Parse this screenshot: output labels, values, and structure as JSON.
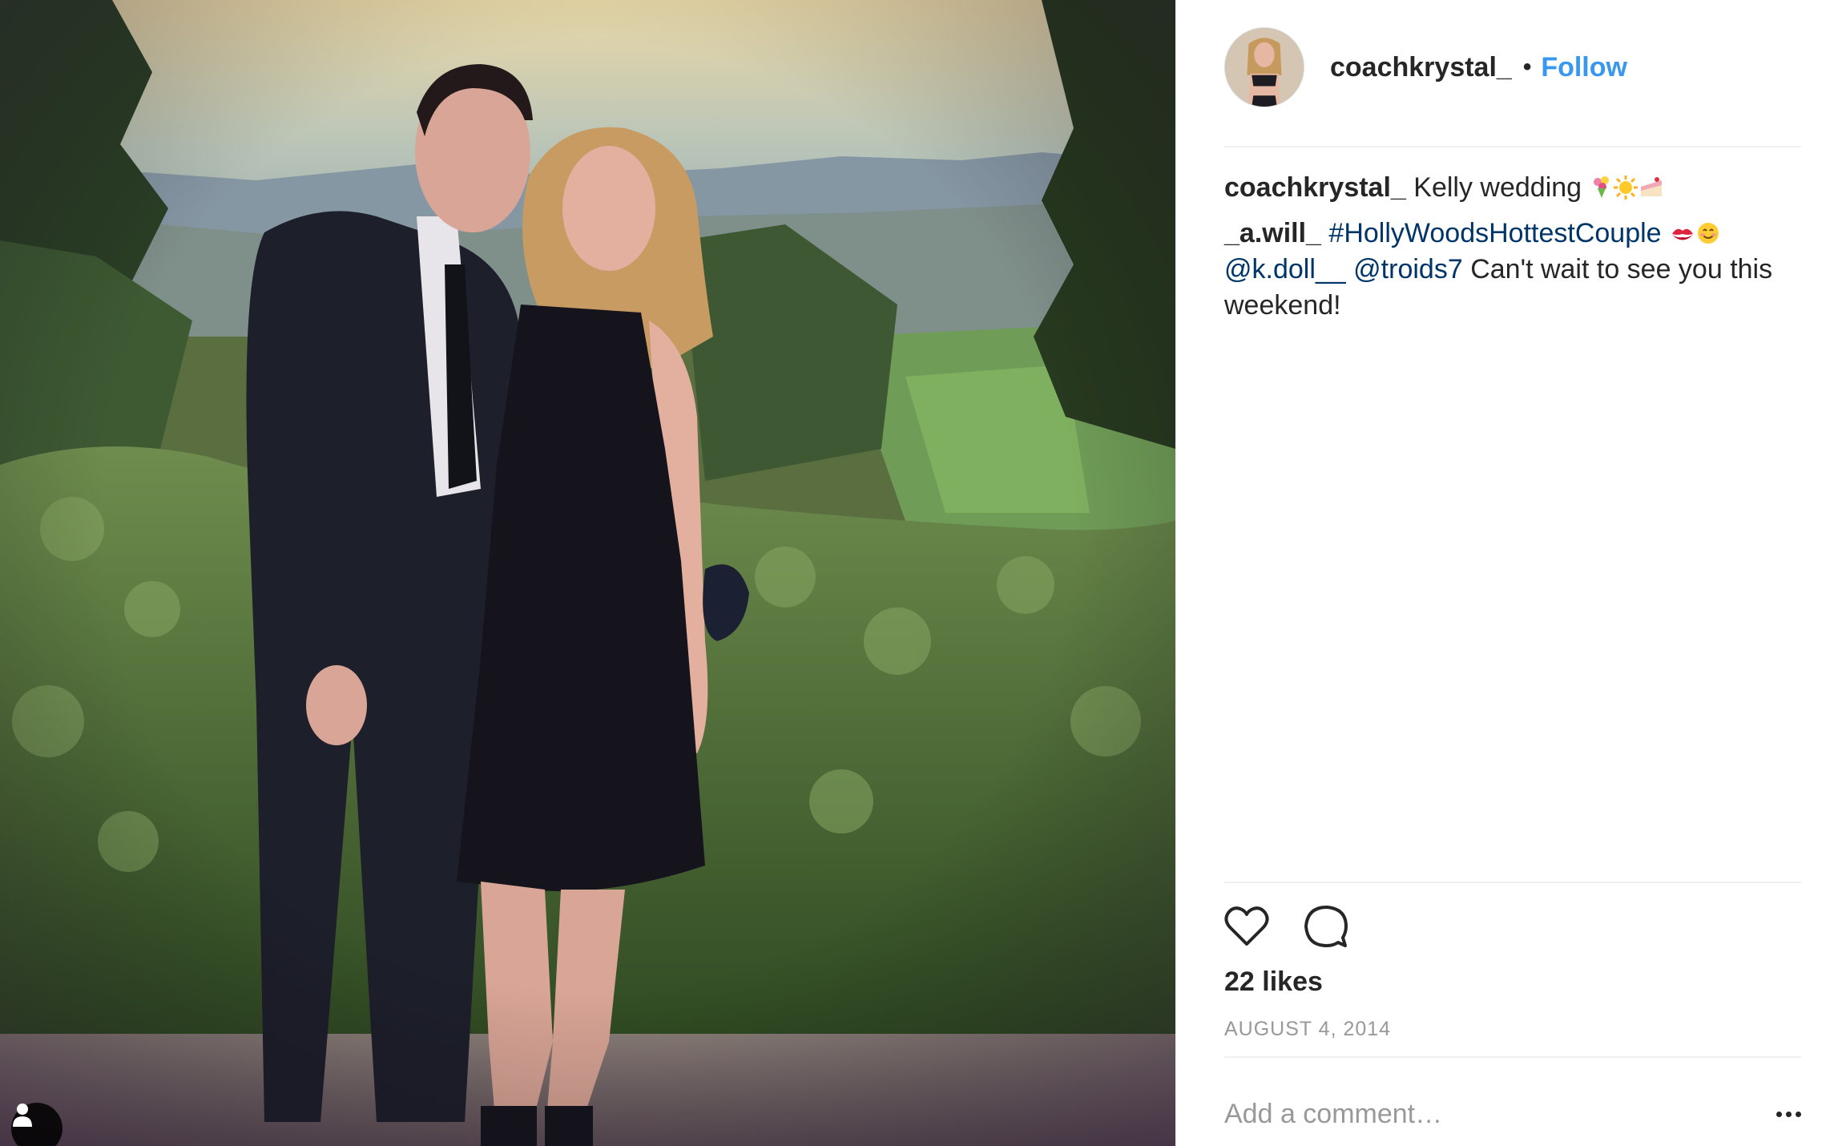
{
  "post": {
    "photo_alt_icon": "tagged-user-icon",
    "author": {
      "username": "coachkrystal_",
      "follow_label": "Follow",
      "separator": "•"
    },
    "comments": [
      {
        "author": "coachkrystal_",
        "text": "Kelly wedding",
        "emoji_icons": [
          "bouquet-emoji-icon",
          "sun-emoji-icon",
          "cake-emoji-icon"
        ]
      },
      {
        "author": "_a.will_",
        "hashtag": "#HollyWoodsHottestCouple",
        "emoji_icons": [
          "kiss-mark-emoji-icon",
          "smiling-face-emoji-icon"
        ],
        "mention_1": "@k.doll__",
        "mention_2": "@troids7",
        "text": "Can't wait to see you this weekend!"
      }
    ],
    "likes_label": "22 likes",
    "date_label": "AUGUST 4, 2014",
    "comment_placeholder": "Add a comment…"
  },
  "colors": {
    "link_blue": "#3897f0",
    "mention_blue": "#003569",
    "muted_gray": "#999999",
    "text": "#262626",
    "divider": "#efefef"
  }
}
